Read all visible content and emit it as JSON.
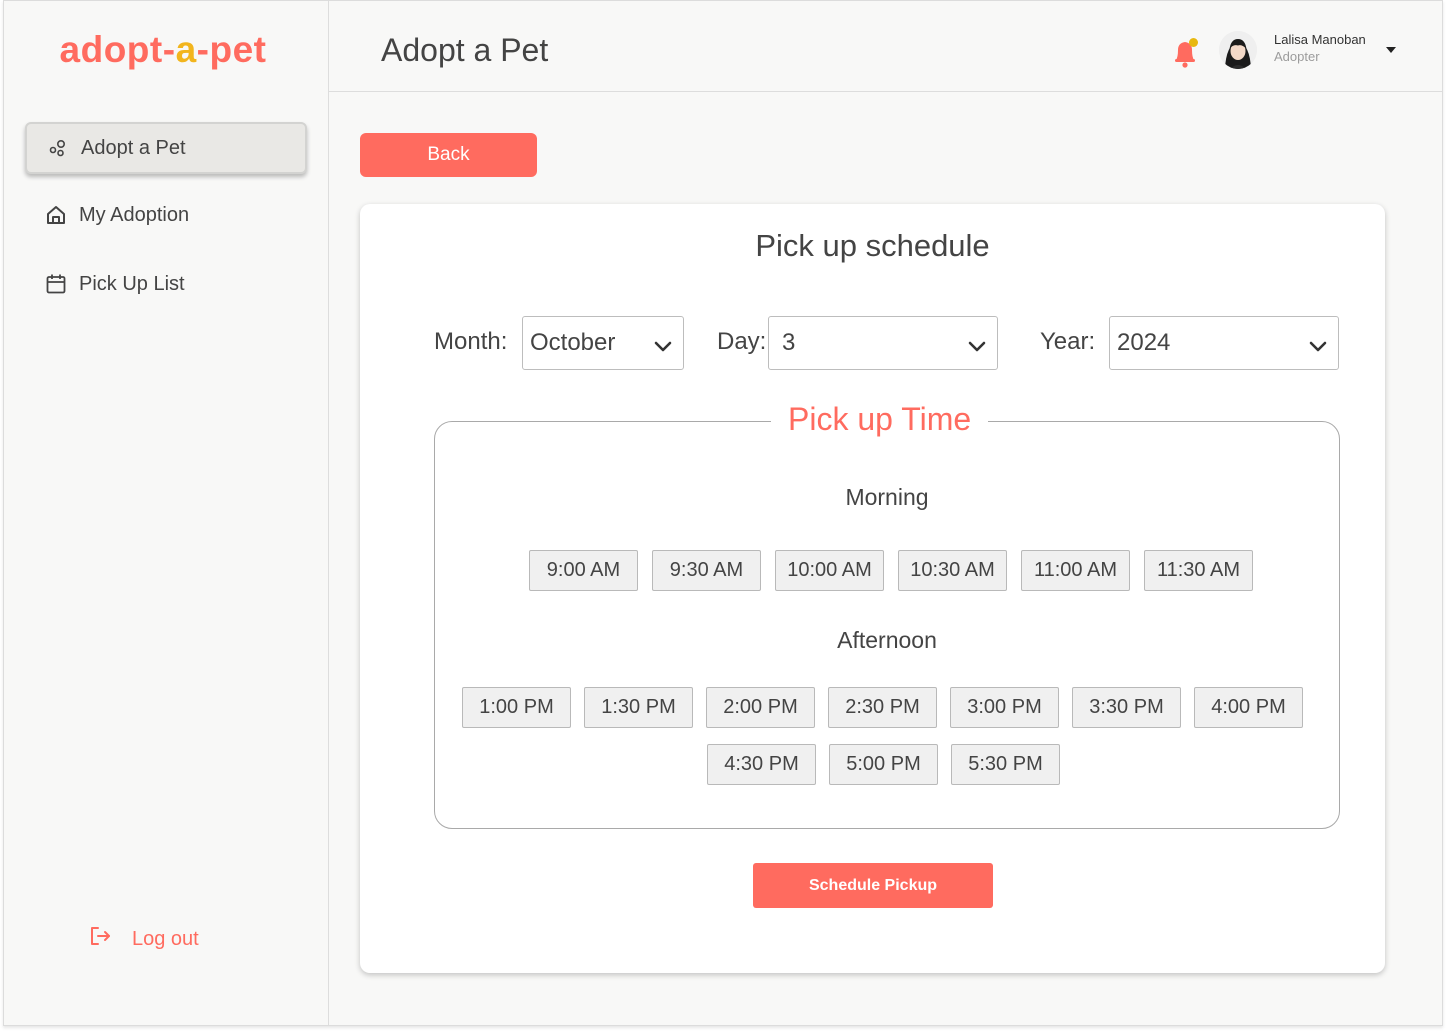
{
  "brand": {
    "logo_part1": "ado",
    "logo_paw": "p",
    "logo_part2": "t-",
    "logo_mid": "a",
    "logo_part3": "-pet",
    "primary_color": "#ff6b5f",
    "accent_color": "#f2b51d"
  },
  "sidebar": {
    "items": [
      {
        "label": "Adopt a Pet",
        "icon": "paw-icon",
        "active": true
      },
      {
        "label": "My Adoption",
        "icon": "house-icon",
        "active": false
      },
      {
        "label": "Pick Up List",
        "icon": "calendar-icon",
        "active": false
      }
    ],
    "logout_label": "Log out"
  },
  "header": {
    "title": "Adopt a Pet",
    "user_name": "Lalisa Manoban",
    "user_role": "Adopter"
  },
  "back_label": "Back",
  "schedule": {
    "title": "Pick up schedule",
    "month_label": "Month:",
    "month_value": "October",
    "day_label": "Day:",
    "day_value": "3",
    "year_label": "Year:",
    "year_value": "2024",
    "time_legend": "Pick up Time",
    "morning_label": "Morning",
    "afternoon_label": "Afternoon",
    "morning_slots": [
      "9:00 AM",
      "9:30 AM",
      "10:00 AM",
      "10:30 AM",
      "11:00 AM",
      "11:30 AM"
    ],
    "afternoon_slots": [
      "1:00 PM",
      "1:30 PM",
      "2:00 PM",
      "2:30 PM",
      "3:00 PM",
      "3:30 PM",
      "4:00 PM",
      "4:30 PM",
      "5:00 PM",
      "5:30 PM"
    ],
    "submit_label": "Schedule Pickup"
  }
}
